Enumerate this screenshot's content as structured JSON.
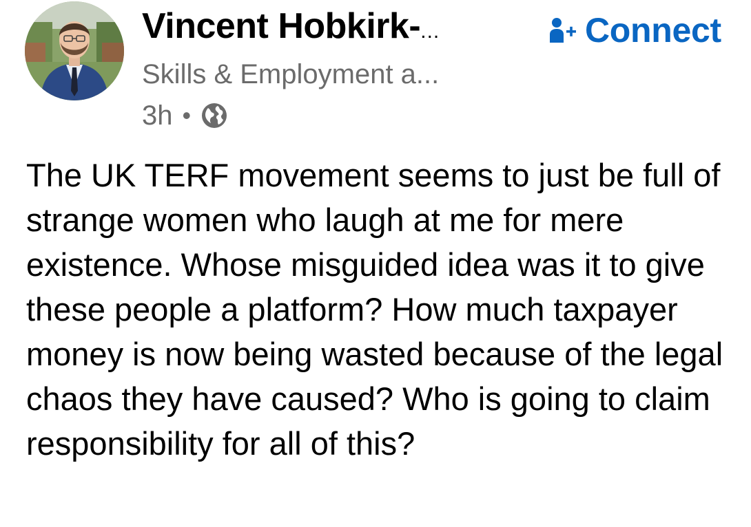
{
  "author": {
    "name": "Vincent Hobkirk-",
    "name_truncation": "...",
    "headline": "Skills & Employment a...",
    "avatar_icon": "profile-photo"
  },
  "connect": {
    "label": "Connect",
    "icon": "person-add-icon",
    "color": "#0a66c2"
  },
  "meta": {
    "time": "3h",
    "separator": "•",
    "visibility_icon": "globe-icon"
  },
  "post": {
    "text": "The UK TERF movement seems to just be full of strange women who laugh at me for mere existence.  Whose misguided idea was it to give these people a platform? How much taxpayer money is now being wasted because of the legal chaos they have caused?  Who is going to claim responsibility for all of this?"
  }
}
